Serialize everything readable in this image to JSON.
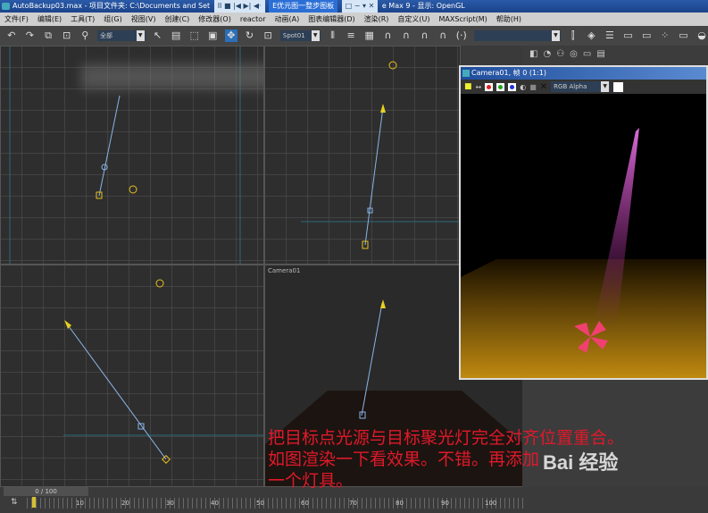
{
  "titlebar": {
    "file": "AutoBackup03.max",
    "project": "- 项目文件夹: C:\\Documents and Set",
    "overlay_tab": "E优元图一整步图板",
    "app": "e Max 9",
    "display": "- 显示: OpenGL"
  },
  "menu": [
    "文件(F)",
    "编辑(E)",
    "工具(T)",
    "组(G)",
    "视图(V)",
    "创建(C)",
    "修改器(O)",
    "reactor",
    "动画(A)",
    "图表编辑器(D)",
    "渲染(R)",
    "自定义(U)",
    "MAXScript(M)",
    "帮助(H)"
  ],
  "toolbar": {
    "selection_filter": "全部",
    "named_selection": "Spot01"
  },
  "viewports": {
    "camera_label": "Camera01"
  },
  "render_window": {
    "title": "Camera01, 帧 0 (1:1)",
    "channel": "RGB Alpha",
    "channel_colors": [
      "#e02020",
      "#20a020",
      "#2030e0"
    ]
  },
  "timeline": {
    "frame": "0 / 100",
    "ticks": [
      "10",
      "20",
      "30",
      "40",
      "50",
      "60",
      "70",
      "80",
      "90",
      "100"
    ]
  },
  "caption": {
    "line1": "把目标点光源与目标聚光灯完全对齐位置重合。",
    "line2": "如图渲染一下看效果。不错。再添加",
    "line3": "一个灯具。"
  },
  "watermark": "Bai 经验"
}
